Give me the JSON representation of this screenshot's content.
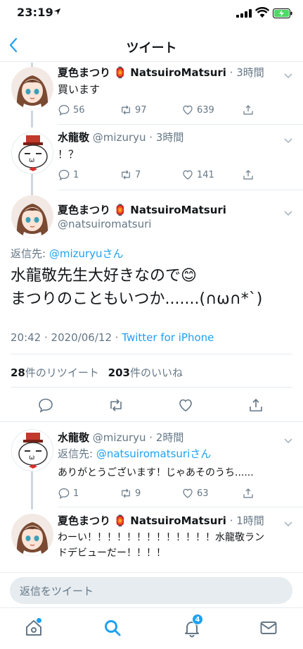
{
  "status": {
    "time": "23:19",
    "location_icon": "location-arrow-icon"
  },
  "nav": {
    "title": "ツイート",
    "back_icon": "chevron-left-icon"
  },
  "tweets": [
    {
      "name": "夏色まつり",
      "emoji": "🏮",
      "handle": "NatsuiroMatsuri",
      "time": "· 3時間",
      "text": "買います",
      "replies": "56",
      "retweets": "97",
      "likes": "639"
    },
    {
      "name": "水龍敬",
      "handle": "@mizuryu",
      "time": "· 3時間",
      "text": "！？",
      "replies": "1",
      "retweets": "7",
      "likes": "141"
    }
  ],
  "main_tweet": {
    "name": "夏色まつり",
    "emoji": "🏮",
    "display": "NatsuiroMatsuri",
    "handle": "@natsuiromatsuri",
    "reply_prefix": "返信先: ",
    "reply_to": "@mizuryu",
    "reply_suffix": "さん",
    "text_line1": "水龍敬先生大好きなので😊",
    "text_line2": "まつりのこともいつか.......(∩ω∩*`)",
    "datetime": "20:42 · 2020/06/12 · ",
    "source": "Twitter for iPhone",
    "retweet_count": "28",
    "retweet_label": "件のリツイート",
    "like_count": "203",
    "like_label": "件のいいね"
  },
  "replies": [
    {
      "name": "水龍敬",
      "handle": "@mizuryu",
      "time": "· 2時間",
      "reply_prefix": "返信先: ",
      "reply_to": "@natsuiromatsuri",
      "reply_suffix": "さん",
      "text": "ありがとうございます！じゃあそのうち......",
      "replies": "1",
      "retweets": "9",
      "likes": "63"
    },
    {
      "name": "夏色まつり",
      "emoji": "🏮",
      "handle": "NatsuiroMatsuri",
      "time": "· 1時間",
      "text_line1": "わーい！！！！！！！！！！！！！水龍敬ラン",
      "text_line2": "ドデビューだー！！！！"
    }
  ],
  "compose": {
    "placeholder": "返信をツイート"
  },
  "tabbar": {
    "notif_count": "4"
  },
  "colors": {
    "accent": "#1da1f2",
    "meta": "#657786",
    "divider": "#e6ecf0"
  }
}
